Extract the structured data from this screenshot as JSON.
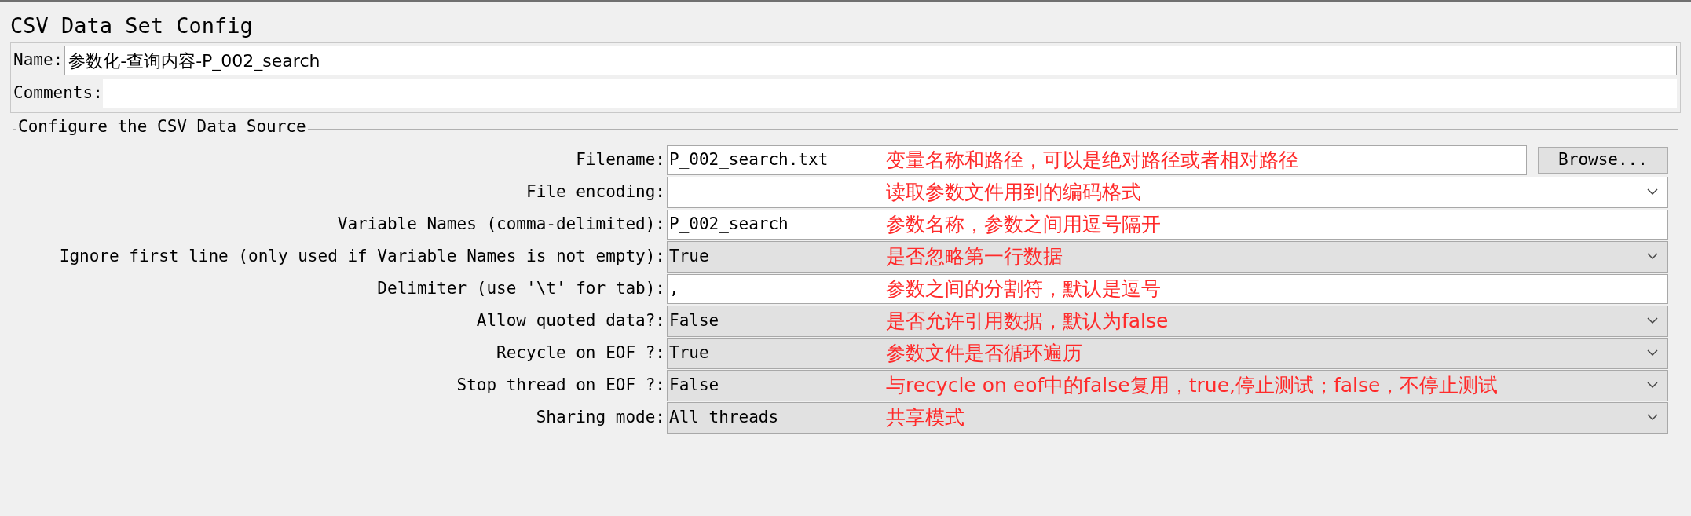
{
  "title": "CSV Data Set Config",
  "name_field": {
    "label": "Name:",
    "value": "参数化-查询内容-P_002_search"
  },
  "comments_field": {
    "label": "Comments:"
  },
  "group": {
    "legend": "Configure the CSV Data Source",
    "rows": [
      {
        "kind": "text",
        "label": "Filename:",
        "value": "P_002_search.txt",
        "note": "变量名称和路径，可以是绝对路径或者相对路径",
        "button": "Browse..."
      },
      {
        "kind": "select",
        "label": "File encoding:",
        "note": "读取参数文件用到的编码格式"
      },
      {
        "kind": "text",
        "label": "Variable Names (comma-delimited):",
        "value": "P_002_search",
        "note": "参数名称，参数之间用逗号隔开"
      },
      {
        "kind": "select",
        "label": "Ignore first line (only used if Variable Names is not empty):",
        "value": "True",
        "note": "是否忽略第一行数据"
      },
      {
        "kind": "text",
        "label": "Delimiter (use '\\t' for tab):",
        "value": ",",
        "note": "参数之间的分割符，默认是逗号"
      },
      {
        "kind": "select",
        "label": "Allow quoted data?:",
        "value": "False",
        "note": "是否允许引用数据，默认为false"
      },
      {
        "kind": "select",
        "label": "Recycle on EOF ?:",
        "value": "True",
        "note": "参数文件是否循环遍历"
      },
      {
        "kind": "select",
        "label": "Stop thread on EOF ?:",
        "value": "False",
        "note": "与recycle on eof中的false复用，true,停止测试；false，不停止测试"
      },
      {
        "kind": "select",
        "label": "Sharing mode:",
        "value": "All threads",
        "note": "共享模式"
      }
    ]
  }
}
